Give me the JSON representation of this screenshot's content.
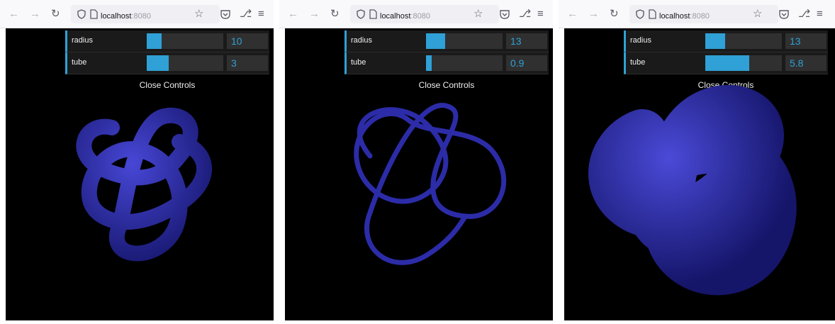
{
  "browser": {
    "url_host": "localhost",
    "url_port": ":8080",
    "icons": [
      "back-arrow-icon",
      "forward-arrow-icon",
      "reload-icon",
      "shield-icon",
      "page-icon",
      "star-icon",
      "pocket-icon",
      "extensions-icon",
      "menu-icon"
    ]
  },
  "gui": {
    "close_label": "Close Controls",
    "radius_label": "radius",
    "tube_label": "tube"
  },
  "colors": {
    "accent": "#2fa1d6",
    "knot": "#2a2aa0",
    "background": "#000000"
  },
  "panels": [
    {
      "radius": "10",
      "tube": "3",
      "radius_fill": 0.19,
      "tube_fill": 0.29
    },
    {
      "radius": "13",
      "tube": "0.9",
      "radius_fill": 0.25,
      "tube_fill": 0.07
    },
    {
      "radius": "13",
      "tube": "5.8",
      "radius_fill": 0.26,
      "tube_fill": 0.57
    }
  ]
}
